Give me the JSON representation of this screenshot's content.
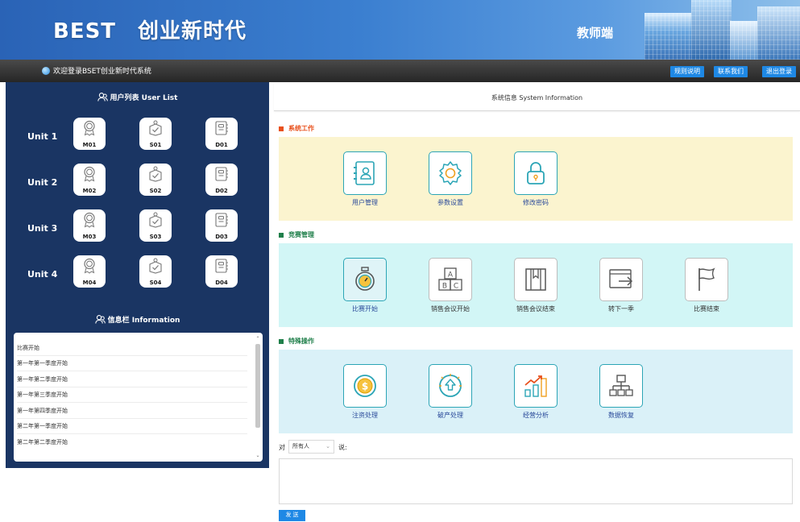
{
  "header": {
    "title": "BEST　创业新时代",
    "role_label": "教师端"
  },
  "topbar": {
    "welcome": "欢迎登录BSET创业新时代系统",
    "buttons": [
      "规则说明",
      "联系我们",
      "退出登录"
    ]
  },
  "user_list": {
    "title": "用户列表 User List",
    "units": [
      {
        "name": "Unit 1",
        "codes": [
          "M01",
          "S01",
          "D01"
        ]
      },
      {
        "name": "Unit 2",
        "codes": [
          "M02",
          "S02",
          "D02"
        ]
      },
      {
        "name": "Unit 3",
        "codes": [
          "M03",
          "S03",
          "D03"
        ]
      },
      {
        "name": "Unit 4",
        "codes": [
          "M04",
          "S04",
          "D04"
        ]
      }
    ]
  },
  "info_panel": {
    "title": "信息栏 Information",
    "items": [
      "比赛开始",
      "第一年第一季度开始",
      "第一年第二季度开始",
      "第一年第三季度开始",
      "第一年第四季度开始",
      "第二年第一季度开始",
      "第二年第二季度开始"
    ]
  },
  "system_info": {
    "title": "系统信息 System Information"
  },
  "sections": [
    {
      "title": "系统工作",
      "color": "#e8501c",
      "bg": "#fbf4cf",
      "items": [
        "用户管理",
        "参数设置",
        "修改密码"
      ]
    },
    {
      "title": "竞赛管理",
      "color": "#1f7f4a",
      "bg": "#d2f6f6",
      "items": [
        "比赛开始",
        "销售会议开始",
        "销售会议结束",
        "转下一季",
        "比赛结束"
      ]
    },
    {
      "title": "特殊操作",
      "color": "#1f7f4a",
      "bg": "#daf1f8",
      "items": [
        "注资处理",
        "破产处理",
        "经营分析",
        "数据恢复"
      ]
    }
  ],
  "chat": {
    "to_label": "对",
    "recipient": "所有人",
    "say_label": "说:",
    "send_label": "发 送"
  },
  "colors": {
    "panel_navy": "#1a3563",
    "accent_blue": "#1e88e5",
    "tile_border": "#2ca5b6"
  }
}
